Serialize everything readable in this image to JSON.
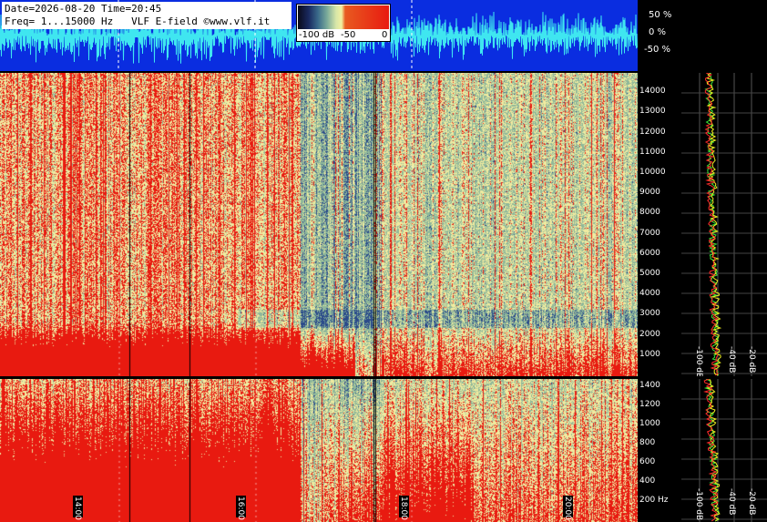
{
  "info": {
    "line1": "Date=2026-08-20 Time=20:45",
    "line2": "Freq= 1...15000 Hz   VLF E-field ©www.vlf.it"
  },
  "colorbar": {
    "labels": [
      "-100 dB",
      "-50",
      "0"
    ]
  },
  "amplitude_labels": [
    "50 %",
    "0 %",
    "-50 %"
  ],
  "freq_axis_upper": [
    "14000",
    "13000",
    "12000",
    "11000",
    "10000",
    "9000",
    "8000",
    "7000",
    "6000",
    "5000",
    "4000",
    "3000",
    "2000",
    "1000"
  ],
  "freq_axis_lower": [
    "1400",
    "1200",
    "1000",
    "800",
    "600",
    "400",
    "200 Hz"
  ],
  "db_labels_upper": [
    "-100 dB",
    "-40 dB",
    "-20 dB"
  ],
  "db_labels_lower": [
    "-100 dB",
    "-40 dB",
    "-20 dB"
  ],
  "time_labels": [
    "14:00",
    "16:00",
    "18:00",
    "20:00"
  ],
  "colors": {
    "waveform_bg": "#0a2de0",
    "waveform_trace": "#3fe6f0",
    "spectrum_red": "#e81a10",
    "spectrum_yellow": "#f0eba0",
    "spectrum_green": "#8fb89a",
    "spectrum_blue": "#2a4a8a",
    "trace_green": "#39e639",
    "trace_yellow": "#f0f020",
    "trace_red": "#ff2a2a"
  }
}
